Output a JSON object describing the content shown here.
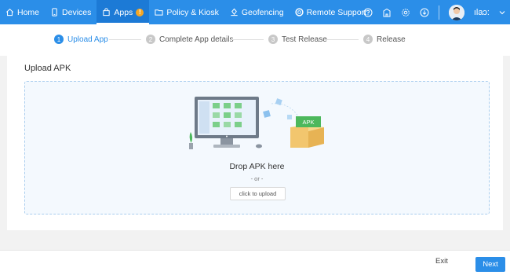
{
  "nav": {
    "items": [
      {
        "label": "Home",
        "icon": "home-icon"
      },
      {
        "label": "Devices",
        "icon": "device-icon"
      },
      {
        "label": "Apps",
        "icon": "apps-bag-icon",
        "badge": "!",
        "active": true
      },
      {
        "label": "Policy & Kiosk",
        "icon": "folder-icon"
      },
      {
        "label": "Geofencing",
        "icon": "geofence-icon"
      },
      {
        "label": "Remote Support",
        "icon": "lifebuoy-icon"
      }
    ],
    "right_icons": [
      "help-icon",
      "building-icon",
      "settings-icon",
      "download-icon"
    ],
    "user_name": "ılaɔ:"
  },
  "stepper": {
    "steps": [
      {
        "num": "1",
        "label": "Upload App",
        "active": true
      },
      {
        "num": "2",
        "label": "Complete App details"
      },
      {
        "num": "3",
        "label": "Test Release"
      },
      {
        "num": "4",
        "label": "Release"
      }
    ]
  },
  "upload": {
    "title": "Upload APK",
    "drop_text": "Drop APK here",
    "or_text": "- or -",
    "button_label": "click to upload",
    "apk_label": "APK"
  },
  "footer": {
    "exit_label": "Exit",
    "next_label": "Next"
  },
  "colors": {
    "primary": "#2b8ee8",
    "badge": "#f5a623",
    "apk_green": "#4cb85c"
  }
}
